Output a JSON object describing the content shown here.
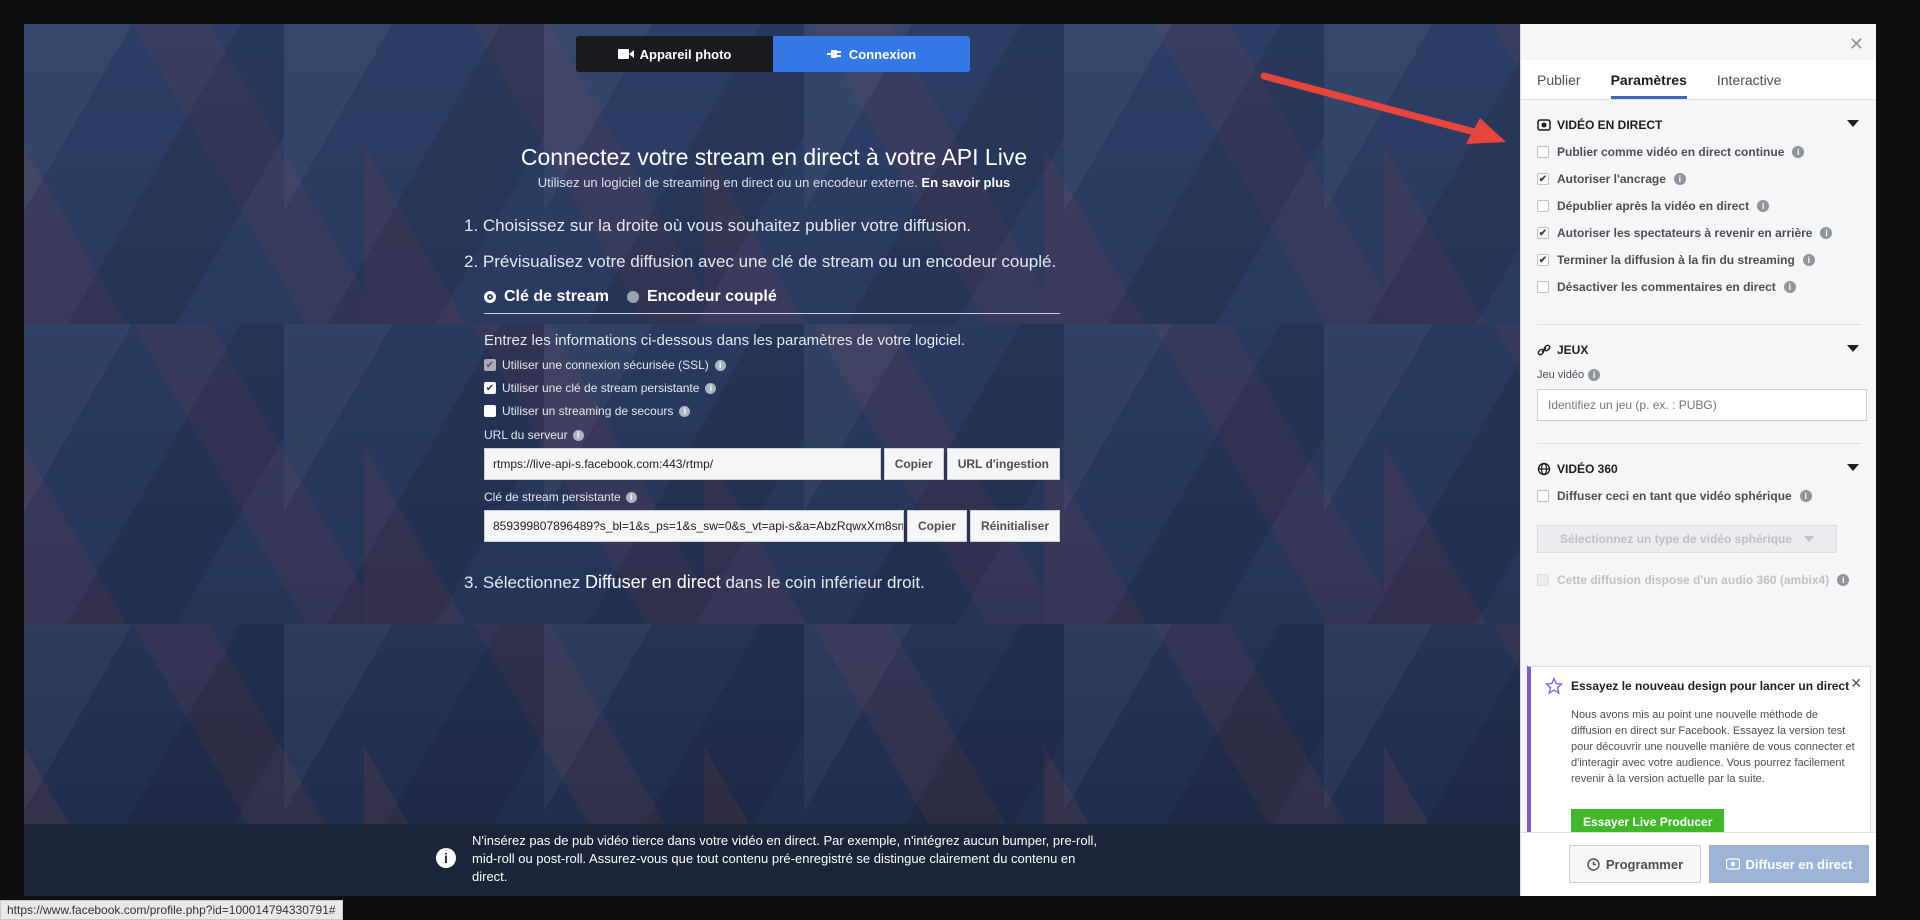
{
  "source_switch": {
    "camera_label": "Appareil photo",
    "connect_label": "Connexion"
  },
  "connect": {
    "title": "Connectez votre stream en direct à votre API Live",
    "subtitle": "Utilisez un logiciel de streaming en direct ou un encodeur externe.",
    "learn_more": "En savoir plus",
    "step1": "1. Choisissez sur la droite où vous souhaitez publier votre diffusion.",
    "step2": "2. Prévisualisez votre diffusion avec une clé de stream ou un encodeur couplé.",
    "mode_stream_key": "Clé de stream",
    "mode_paired_encoder": "Encodeur couplé",
    "enter_info": "Entrez les informations ci-dessous dans les paramètres de votre logiciel.",
    "opt_ssl": "Utiliser une connexion sécurisée (SSL)",
    "opt_persistent": "Utiliser une clé de stream persistante",
    "opt_backup": "Utiliser un streaming de secours",
    "server_url_label": "URL du serveur",
    "server_url_value": "rtmps://live-api-s.facebook.com:443/rtmp/",
    "copy_label": "Copier",
    "ingest_label": "URL d'ingestion",
    "stream_key_label": "Clé de stream persistante",
    "stream_key_value": "859399807896489?s_bl=1&s_ps=1&s_sw=0&s_vt=api-s&a=AbzRqwxXm8sn",
    "reset_label": "Réinitialiser",
    "step3_prefix": "3. Sélectionnez",
    "step3_bold": "Diffuser en direct",
    "step3_suffix": "dans le coin inférieur droit."
  },
  "notice": {
    "text": "N'insérez pas de pub vidéo tierce dans votre vidéo en direct. Par exemple, n'intégrez aucun bumper, pre-roll, mid-roll ou post-roll. Assurez-vous que tout contenu pré-enregistré se distingue clairement du contenu en direct."
  },
  "panel": {
    "tabs": [
      "Publier",
      "Paramètres",
      "Interactive"
    ],
    "live_video": {
      "title": "VIDÉO EN DIRECT",
      "options": [
        {
          "label": "Publier comme vidéo en direct continue",
          "checked": false
        },
        {
          "label": "Autoriser l'ancrage",
          "checked": true
        },
        {
          "label": "Dépublier après la vidéo en direct",
          "checked": false
        },
        {
          "label": "Autoriser les spectateurs à revenir en arrière",
          "checked": true
        },
        {
          "label": "Terminer la diffusion à la fin du streaming",
          "checked": true
        },
        {
          "label": "Désactiver les commentaires en direct",
          "checked": false
        }
      ]
    },
    "games": {
      "title": "JEUX",
      "field_label": "Jeu vidéo",
      "placeholder": "Identifiez un jeu (p. ex. : PUBG)"
    },
    "video360": {
      "title": "VIDÉO 360",
      "spherical_label": "Diffuser ceci en tant que vidéo sphérique",
      "select_placeholder": "Sélectionnez un type de vidéo sphérique",
      "audio360_label": "Cette diffusion dispose d'un audio 360 (ambix4)"
    },
    "promo": {
      "title": "Essayez le nouveau design pour lancer un direct",
      "text": "Nous avons mis au point une nouvelle méthode de diffusion en direct sur Facebook. Essayez la version test pour découvrir une nouvelle manière de vous connecter et d'interagir avec votre audience. Vous pourrez facilement revenir à la version actuelle par la suite.",
      "button": "Essayer Live Producer"
    },
    "footer": {
      "schedule": "Programmer",
      "go_live": "Diffuser en direct"
    }
  },
  "status_bar": {
    "url": "https://www.facebook.com/profile.php?id=100014794330791#"
  },
  "colors": {
    "accent": "#3578e5",
    "tab_underline": "#4267b2",
    "promo_button": "#42b72a",
    "arrow": "#e8453c"
  }
}
